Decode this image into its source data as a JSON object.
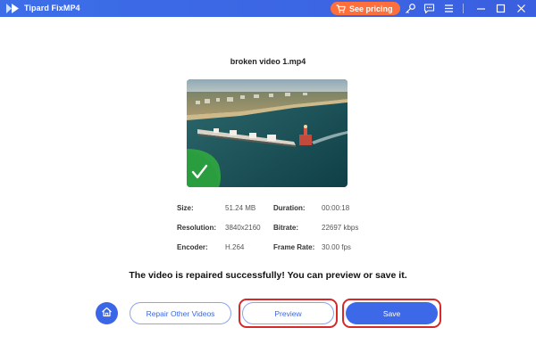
{
  "window": {
    "title": "Tipard FixMP4",
    "pricing_label": "See pricing",
    "icons": [
      "logo-icon",
      "cart-icon",
      "key-icon",
      "feedback-icon",
      "menu-icon",
      "minimize-icon",
      "maximize-icon",
      "close-icon"
    ]
  },
  "video": {
    "file_name": "broken video 1.mp4",
    "status_icon": "checkmark-icon"
  },
  "info": {
    "size_label": "Size:",
    "size_value": "51.24 MB",
    "duration_label": "Duration:",
    "duration_value": "00:00:18",
    "resolution_label": "Resolution:",
    "resolution_value": "3840x2160",
    "bitrate_label": "Bitrate:",
    "bitrate_value": "22697 kbps",
    "encoder_label": "Encoder:",
    "encoder_value": "H.264",
    "framerate_label": "Frame Rate:",
    "framerate_value": "30.00 fps"
  },
  "message": "The video is repaired successfully! You can preview or save it.",
  "actions": {
    "home_icon": "home-icon",
    "repair_other_label": "Repair Other Videos",
    "preview_label": "Preview",
    "save_label": "Save"
  },
  "colors": {
    "titlebar": "#3a62e4",
    "accent": "#3d68e8",
    "pricing": "#ff6f3c",
    "highlight": "#d42a2a",
    "success": "#2ea043"
  }
}
